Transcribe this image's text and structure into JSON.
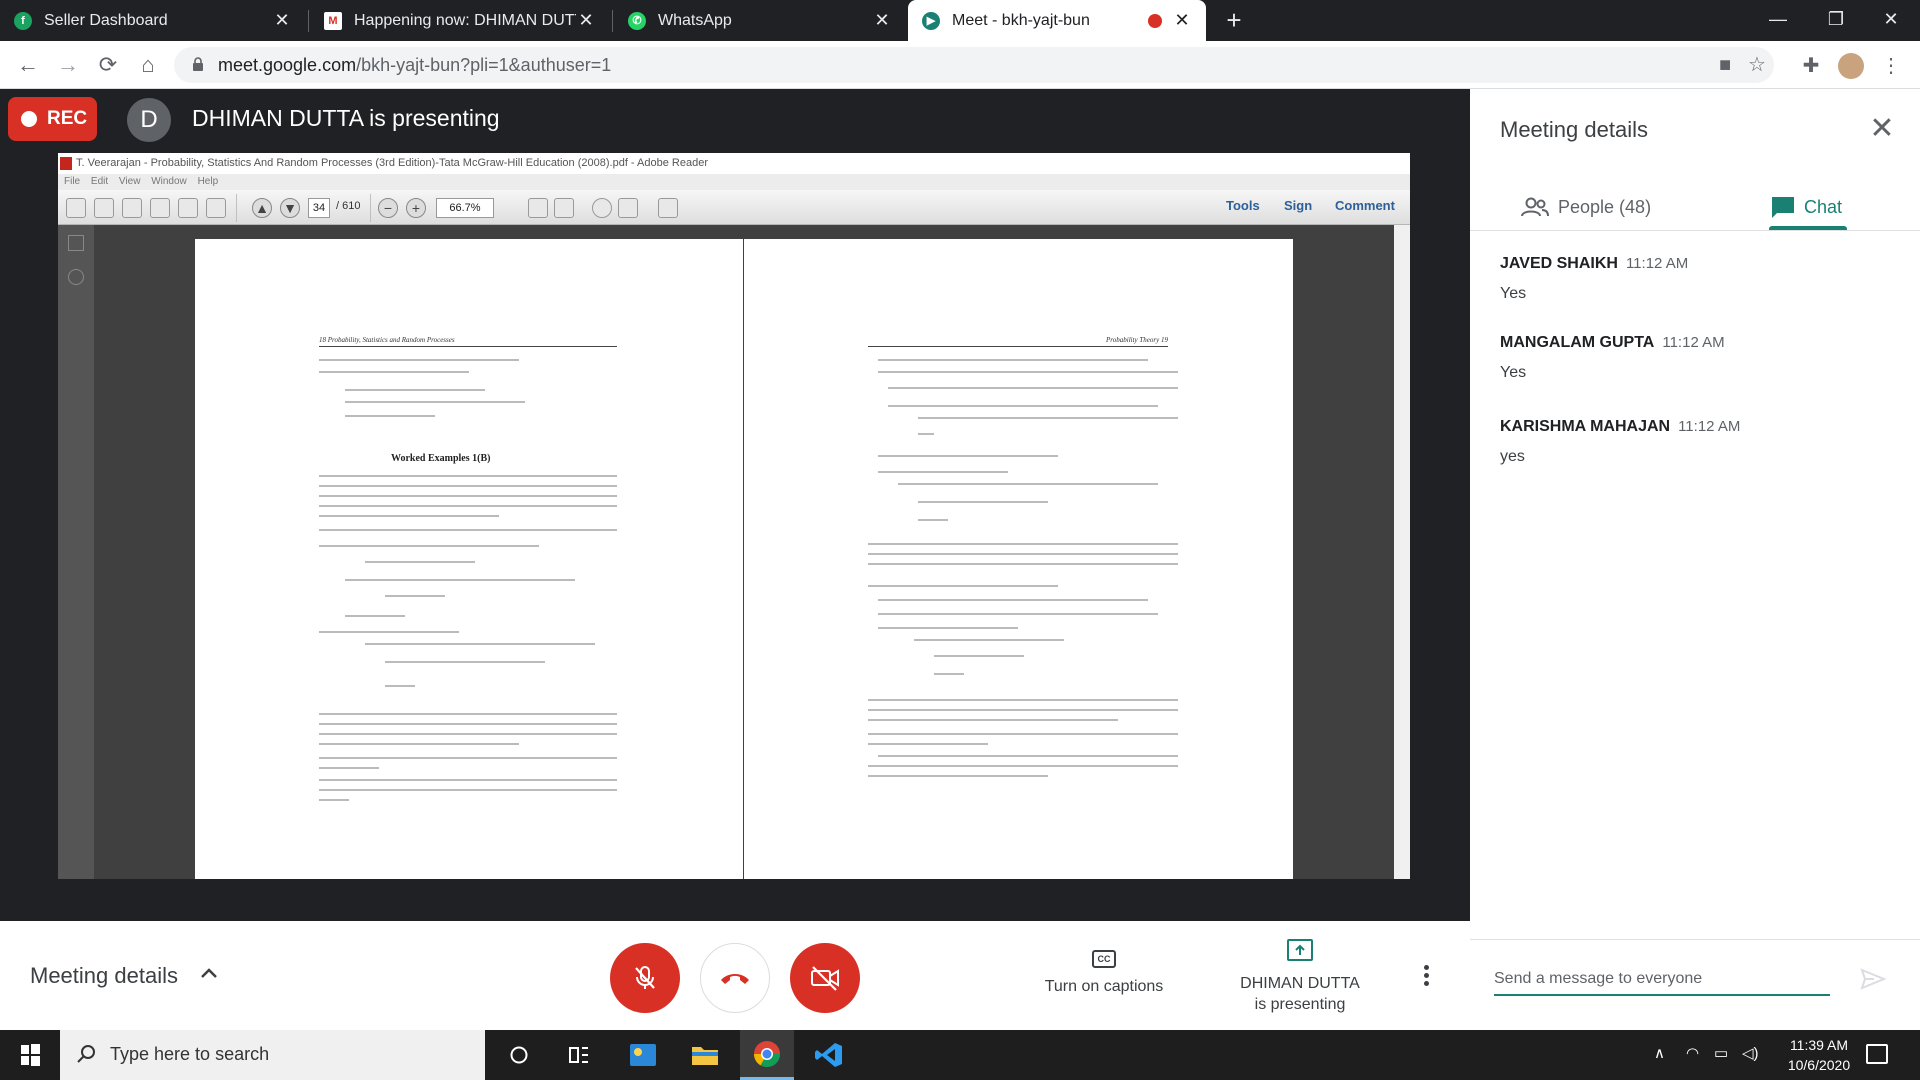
{
  "browser": {
    "tabs": [
      {
        "title": "Seller Dashboard",
        "icon": "seller-icon"
      },
      {
        "title": "Happening now: DHIMAN DUTTA",
        "icon": "gmail-icon"
      },
      {
        "title": "WhatsApp",
        "icon": "whatsapp-icon"
      },
      {
        "title": "Meet - bkh-yajt-bun",
        "icon": "meet-icon",
        "active": true
      }
    ],
    "url_host": "meet.google.com",
    "url_path": "/bkh-yajt-bun?pli=1&authuser=1"
  },
  "meet": {
    "rec_label": "REC",
    "presenter_initial": "D",
    "presenting_title": "DHIMAN DUTTA is presenting",
    "meeting_details_label": "Meeting details",
    "captions_label": "Turn on captions",
    "captions_icon": "CC",
    "presenting_line1": "DHIMAN DUTTA",
    "presenting_line2": "is presenting"
  },
  "reader": {
    "title": "T. Veerarajan - Probability, Statistics And Random Processes (3rd Edition)-Tata McGraw-Hill Education (2008).pdf - Adobe Reader",
    "menu": [
      "File",
      "Edit",
      "View",
      "Window",
      "Help"
    ],
    "page_current": "34",
    "page_total": "/ 610",
    "zoom": "66.7%",
    "tools_label": "Tools",
    "sign_label": "Sign",
    "comment_label": "Comment",
    "left_page_header": "18      Probability, Statistics and Random Processes",
    "right_page_header": "Probability Theory      19",
    "left_heading": "Worked Examples 1(B)"
  },
  "panel": {
    "title": "Meeting details",
    "people_label": "People (48)",
    "chat_label": "Chat",
    "messages": [
      {
        "sender": "JAVED SHAIKH",
        "time": "11:12 AM",
        "text": "Yes"
      },
      {
        "sender": "MANGALAM GUPTA",
        "time": "11:12 AM",
        "text": "Yes"
      },
      {
        "sender": "KARISHMA MAHAJAN",
        "time": "11:12 AM",
        "text": "yes"
      }
    ],
    "input_placeholder": "Send a message to everyone"
  },
  "taskbar": {
    "search_placeholder": "Type here to search",
    "time": "11:39 AM",
    "date": "10/6/2020"
  },
  "colors": {
    "meet_red": "#d93025",
    "meet_teal": "#1a8074",
    "dark_bg": "#202124"
  }
}
